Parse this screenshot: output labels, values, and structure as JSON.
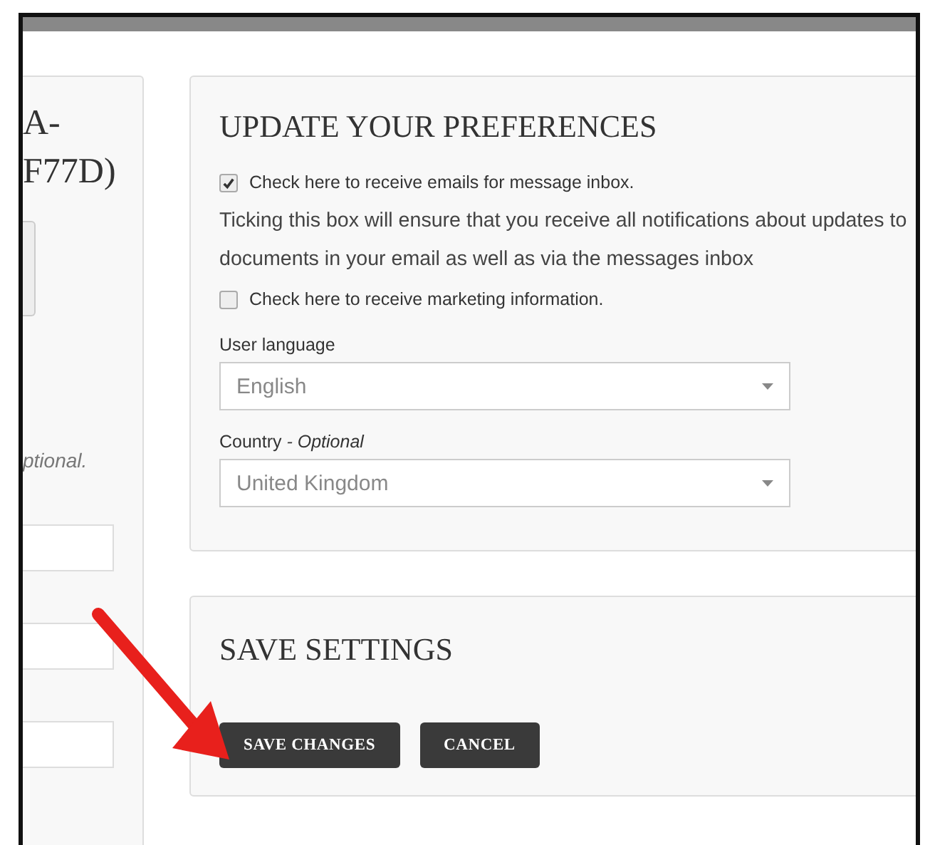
{
  "left_panel": {
    "title_lines": [
      "A-",
      "F77D)"
    ],
    "note": "ptional.",
    "fields": [
      {
        "kind": "text"
      },
      {
        "kind": "text"
      },
      {
        "kind": "text"
      }
    ]
  },
  "preferences": {
    "title": "UPDATE YOUR PREFERENCES",
    "options": [
      {
        "label": "Check here to receive emails for message inbox.",
        "checked": true,
        "description": "Ticking this box will ensure that you receive all notifications about updates to documents in your email as well as via the messages inbox"
      },
      {
        "label": "Check here to receive marketing information.",
        "checked": false
      }
    ],
    "selects": [
      {
        "label": "User language",
        "value": "English"
      },
      {
        "label": "Country *- Optional*",
        "value": "United Kingdom"
      }
    ]
  },
  "save_settings": {
    "title": "SAVE SETTINGS",
    "buttons": [
      "SAVE CHANGES",
      "CANCEL"
    ]
  }
}
